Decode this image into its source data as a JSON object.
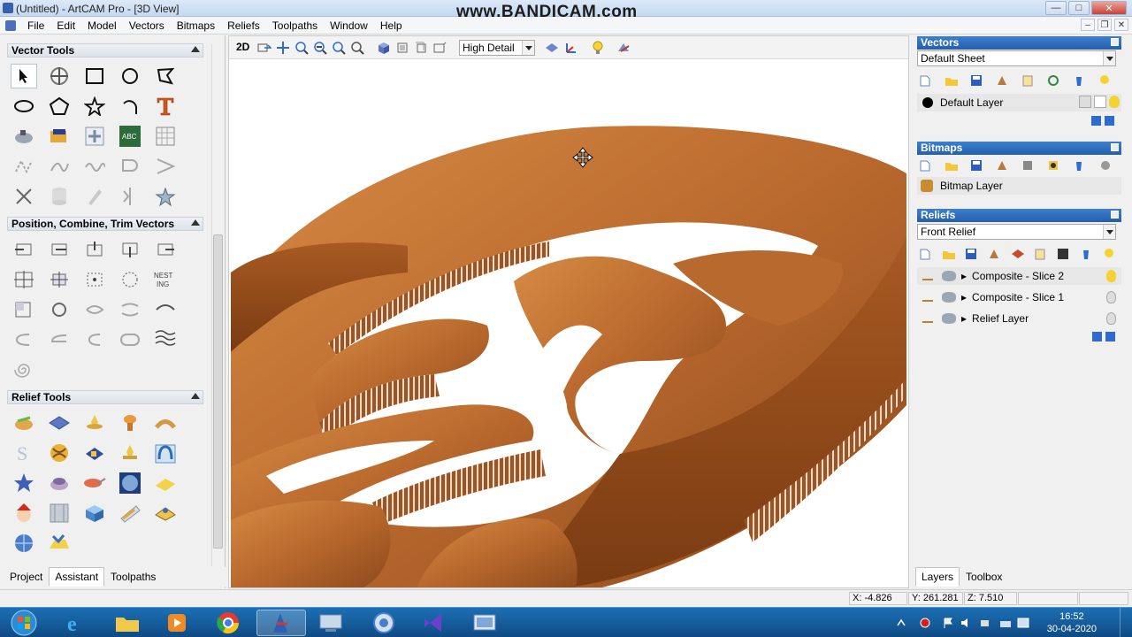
{
  "window": {
    "title": "(Untitled) - ArtCAM Pro - [3D View]",
    "watermark": "www.BANDICAM.com",
    "buttons": {
      "minimize": "—",
      "maximize": "□",
      "close": "✕"
    }
  },
  "menu": [
    "File",
    "Edit",
    "Model",
    "Vectors",
    "Bitmaps",
    "Reliefs",
    "Toolpaths",
    "Window",
    "Help"
  ],
  "mdi_buttons": {
    "minimize": "–",
    "restore": "❐",
    "close": "✕"
  },
  "left": {
    "sections": {
      "vector_tools": "Vector Tools",
      "position": "Position, Combine, Trim Vectors",
      "relief_tools": "Relief Tools"
    },
    "text_tool_glyphs": {
      "nest": "NEST",
      "nest_sub": "ING"
    },
    "tabs": [
      "Project",
      "Assistant",
      "Toolpaths"
    ],
    "active_tab": "Assistant"
  },
  "view": {
    "mode_button": "2D",
    "detail_select": "High Detail"
  },
  "right": {
    "vectors": {
      "header": "Vectors",
      "sheet": "Default Sheet",
      "layer": "Default Layer"
    },
    "bitmaps": {
      "header": "Bitmaps",
      "layer": "Bitmap Layer"
    },
    "reliefs": {
      "header": "Reliefs",
      "relief": "Front Relief",
      "layers": [
        "Composite - Slice 2",
        "Composite - Slice 1",
        "Relief Layer"
      ]
    },
    "tabs": [
      "Layers",
      "Toolbox"
    ],
    "active_tab": "Layers"
  },
  "status": {
    "x": "X: -4.826",
    "y": "Y: 261.281",
    "z": "Z: 7.510"
  },
  "taskbar": {
    "time": "16:52",
    "date": "30-04-2020"
  },
  "colors": {
    "wood_light": "#c47a3d",
    "wood_dark": "#8a4a1e",
    "panel_header": "#2a67b5",
    "taskbar": "#155a98"
  }
}
